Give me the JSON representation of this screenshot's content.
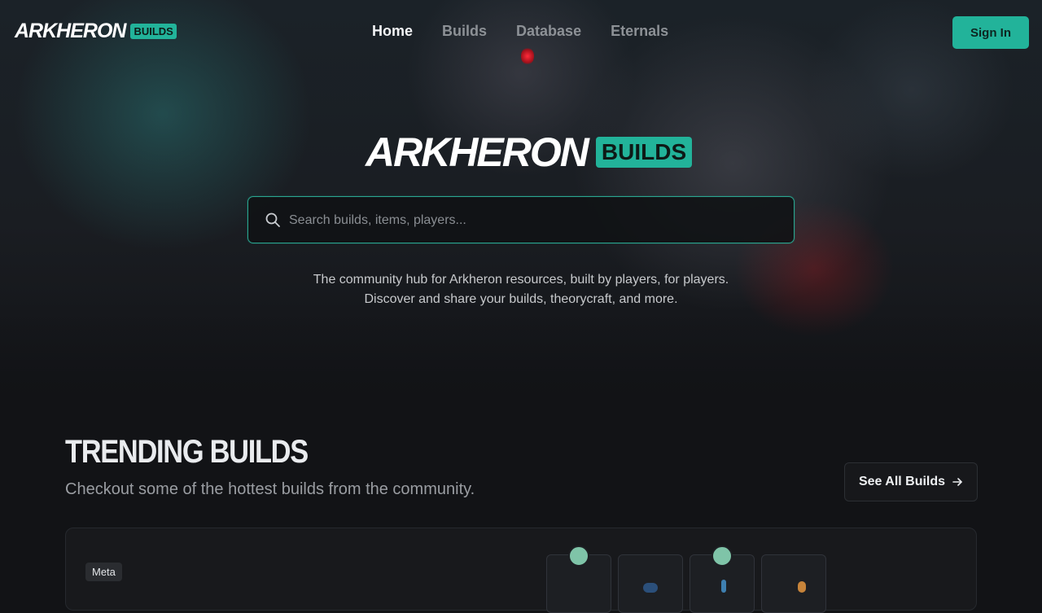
{
  "nav": {
    "brand": "ARKHERON",
    "brand_badge": "BUILDS",
    "links": [
      "Home",
      "Builds",
      "Database",
      "Eternals"
    ],
    "active": "Home",
    "signin_label": "Sign In"
  },
  "hero": {
    "brand": "ARKHERON",
    "brand_badge": "BUILDS",
    "search_placeholder": "Search builds, items, players...",
    "tagline_line1": "The community hub for Arkheron resources, built by players, for players.",
    "tagline_line2": "Discover and share your builds, theorycraft, and more."
  },
  "trending": {
    "title": "TRENDING BUILDS",
    "subtitle": "Checkout some of the hottest builds from the community.",
    "see_all_label": "See All Builds"
  },
  "build_card": {
    "tag": "Meta"
  },
  "colors": {
    "accent": "#22b39a",
    "background": "#121316"
  }
}
